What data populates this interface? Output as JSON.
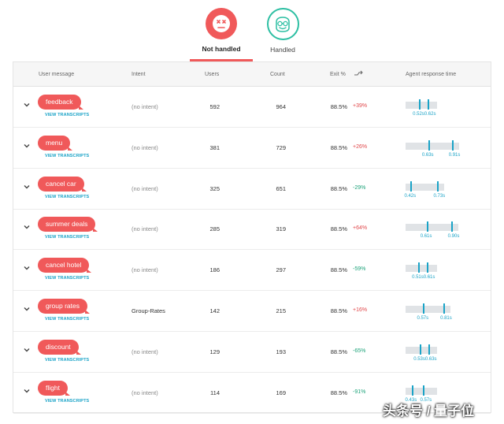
{
  "tabs": {
    "not_handled": "Not handled",
    "handled": "Handled"
  },
  "columns": {
    "user_message": "User message",
    "intent": "Intent",
    "users": "Users",
    "count": "Count",
    "exit": "Exit %",
    "trend_icon": "trend-arrows-icon",
    "agent_response": "Agent response time"
  },
  "view_label": "VIEW TRANSCRIPTS",
  "rows": [
    {
      "message": "feedback",
      "intent": "(no intent)",
      "users": "592",
      "count": "964",
      "exit": "88.5%",
      "change": "+39%",
      "t1": "0.52s",
      "t2": "0.62s",
      "v1": 0.52,
      "v2": 0.62
    },
    {
      "message": "menu",
      "intent": "(no intent)",
      "users": "381",
      "count": "729",
      "exit": "88.5%",
      "change": "+26%",
      "t1": "0.63s",
      "t2": "0.91s",
      "v1": 0.63,
      "v2": 0.91
    },
    {
      "message": "cancel car",
      "intent": "(no intent)",
      "users": "325",
      "count": "651",
      "exit": "88.5%",
      "change": "-29%",
      "t1": "0.42s",
      "t2": "0.73s",
      "v1": 0.42,
      "v2": 0.73
    },
    {
      "message": "summer deals",
      "intent": "(no intent)",
      "users": "285",
      "count": "319",
      "exit": "88.5%",
      "change": "+64%",
      "t1": "0.61s",
      "t2": "0.90s",
      "v1": 0.61,
      "v2": 0.9
    },
    {
      "message": "cancel hotel",
      "intent": "(no intent)",
      "users": "186",
      "count": "297",
      "exit": "88.5%",
      "change": "-59%",
      "t1": "0.51s",
      "t2": "0.61s",
      "v1": 0.51,
      "v2": 0.61
    },
    {
      "message": "group rates",
      "intent": "Group-Rates",
      "users": "142",
      "count": "215",
      "exit": "88.5%",
      "change": "+16%",
      "t1": "0.57s",
      "t2": "0.81s",
      "v1": 0.57,
      "v2": 0.81
    },
    {
      "message": "discount",
      "intent": "(no intent)",
      "users": "129",
      "count": "193",
      "exit": "88.5%",
      "change": "-65%",
      "t1": "0.53s",
      "t2": "0.63s",
      "v1": 0.53,
      "v2": 0.63
    },
    {
      "message": "flight",
      "intent": "(no intent)",
      "users": "114",
      "count": "169",
      "exit": "88.5%",
      "change": "-91%",
      "t1": "0.43s",
      "t2": "0.57s",
      "v1": 0.43,
      "v2": 0.57
    }
  ],
  "colors": {
    "accent": "#f0595a",
    "handled": "#2dbfa3",
    "link": "#1aa3c7",
    "up": "#e0474a",
    "down": "#1ea37a"
  },
  "watermark": "头条号 / 量子位"
}
